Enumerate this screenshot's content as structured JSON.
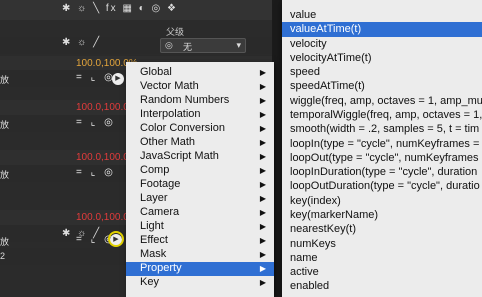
{
  "layers_panel": {
    "top_icons": "✱ ☼ ╲ fx ▦ ◐ ◎ ❖",
    "parent_label": "父级",
    "parent_value": "无",
    "cut_label": "放",
    "row_num": "2",
    "values": [
      {
        "text": "100.0,100.0%",
        "color": "yellow"
      },
      {
        "text": "100.0,100.0%",
        "color": "red"
      },
      {
        "text": "100.0,100.0%",
        "color": "red"
      },
      {
        "text": "100.0,100.0%",
        "color": "red"
      }
    ]
  },
  "menu_categories": {
    "items": [
      "Global",
      "Vector Math",
      "Random Numbers",
      "Interpolation",
      "Color Conversion",
      "Other Math",
      "JavaScript Math",
      "Comp",
      "Footage",
      "Layer",
      "Camera",
      "Light",
      "Effect",
      "Mask",
      "Property",
      "Key"
    ],
    "selected": "Property",
    "accent_color": "#2f6fd3"
  },
  "menu_property": {
    "items": [
      "value",
      "valueAtTime(t)",
      "velocity",
      "velocityAtTime(t)",
      "speed",
      "speedAtTime(t)",
      "wiggle(freq, amp, octaves = 1, amp_mu",
      "temporalWiggle(freq, amp, octaves = 1,",
      "smooth(width = .2, samples = 5, t = tim",
      "loopIn(type = \"cycle\", numKeyframes =",
      "loopOut(type = \"cycle\", numKeyframes",
      "loopInDuration(type = \"cycle\", duration",
      "loopOutDuration(type = \"cycle\", duratio",
      "key(index)",
      "key(markerName)",
      "nearestKey(t)",
      "numKeys",
      "name",
      "active",
      "enabled"
    ],
    "selected": "valueAtTime(t)"
  }
}
